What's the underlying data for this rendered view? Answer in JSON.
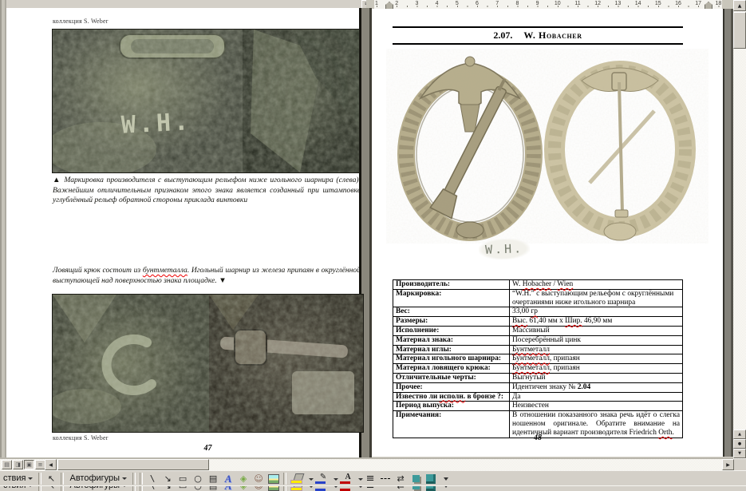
{
  "ui": {
    "ruler_numbers": [
      "1",
      "2",
      "3",
      "4",
      "5",
      "6",
      "7",
      "8",
      "9",
      "10",
      "11",
      "12",
      "13",
      "14",
      "15",
      "16",
      "17",
      "18"
    ],
    "drawing_toolbar": {
      "draw_menu_label": "ствия",
      "autoshapes_label": "Автофигуры",
      "icons": [
        {
          "name": "select-pointer-icon"
        },
        {
          "name": "sep",
          "sep": true
        },
        {
          "name": "line-icon"
        },
        {
          "name": "arrow-icon"
        },
        {
          "name": "rectangle-icon"
        },
        {
          "name": "oval-icon"
        },
        {
          "name": "text-box-icon"
        },
        {
          "name": "wordart-icon"
        },
        {
          "name": "diagram-icon"
        },
        {
          "name": "clip-art-icon"
        },
        {
          "name": "picture-icon"
        },
        {
          "name": "sep",
          "sep": true
        },
        {
          "name": "fill-color-icon",
          "dropdown": true
        },
        {
          "name": "line-color-icon",
          "dropdown": true
        },
        {
          "name": "font-color-icon",
          "dropdown": true
        },
        {
          "name": "line-style-icon"
        },
        {
          "name": "dash-style-icon"
        },
        {
          "name": "arrow-style-icon"
        },
        {
          "name": "shadow-style-icon"
        },
        {
          "name": "threed-style-icon"
        },
        {
          "name": "toolbar-options-icon"
        }
      ]
    }
  },
  "left_page": {
    "credit_top": "коллекция S. Weber",
    "credit_bottom": "коллекция S. Weber",
    "photo1_stamp": "W.H.",
    "caption1_parts": [
      {
        "t": "▲  ",
        "b": 1
      },
      {
        "t": "Маркировка производителя с выступающим рельефом ниже игольного шарнира (слева). Важнейшим отличительным признаком этого знака является созданный при штамповке углублённый рельеф обратной стороны  приклада винтовки"
      }
    ],
    "caption2_parts": [
      {
        "t": "Ловящий крюк состоит  из "
      },
      {
        "t": "бунтметалла",
        "sp": 1
      },
      {
        "t": ". Игольный шарнир из железа припаян в округлённой выступающей над поверхностью знака площадке. "
      },
      {
        "t": "▼",
        "b": 1
      }
    ],
    "page_number": "47"
  },
  "right_page": {
    "header_num": "2.07.",
    "header_title": "W. Hobacher",
    "stamp_text": "W.H.",
    "page_number": "48",
    "table": {
      "rows": [
        {
          "label": [
            {
              "t": "Производитель:"
            }
          ],
          "value": [
            {
              "t": "W. "
            },
            {
              "t": "Hobacher",
              "sp": 1
            },
            {
              "t": " / "
            },
            {
              "t": "Wien",
              "sp": 1
            }
          ]
        },
        {
          "label": [
            {
              "t": "Маркировка:"
            }
          ],
          "value": [
            {
              "t": "“W.H.” с выступающим рельефом с округлёнными очертаниями ниже игольного шарнира"
            }
          ]
        },
        {
          "label": [
            {
              "t": "Вес:"
            }
          ],
          "value": [
            {
              "t": "33,00 "
            },
            {
              "t": "гр",
              "sp": 1
            }
          ]
        },
        {
          "label": [
            {
              "t": "Размеры:"
            }
          ],
          "value": [
            {
              "t": "Выс.",
              "sp": 1
            },
            {
              "t": " 61,40 мм  х  "
            },
            {
              "t": "Шир.",
              "sp": 1
            },
            {
              "t": " 46,90 мм"
            }
          ]
        },
        {
          "label": [
            {
              "t": "Исполнение:"
            }
          ],
          "value": [
            {
              "t": "Массивный"
            }
          ]
        },
        {
          "label": [
            {
              "t": "Материал знака:"
            }
          ],
          "value": [
            {
              "t": "Посеребрённый цинк"
            }
          ]
        },
        {
          "label": [
            {
              "t": "Материал иглы:"
            }
          ],
          "value": [
            {
              "t": "Бунтметалл",
              "sp": 1
            }
          ]
        },
        {
          "label": [
            {
              "t": "Материал игольного шарнира:"
            }
          ],
          "value": [
            {
              "t": "Бунтметалл",
              "sp": 1
            },
            {
              "t": ", припаян"
            }
          ]
        },
        {
          "label": [
            {
              "t": "Материал ловящего крюка:"
            }
          ],
          "value": [
            {
              "t": "Бунтметалл",
              "sp": 1
            },
            {
              "t": ", припаян"
            }
          ]
        },
        {
          "label": [
            {
              "t": "Отличительные черты:"
            }
          ],
          "value": [
            {
              "t": "Выгнутый"
            }
          ]
        },
        {
          "label": [
            {
              "t": "Прочее:"
            }
          ],
          "value": [
            {
              "t": "Идентичен знаку № "
            },
            {
              "t": "2.04",
              "b": 1
            }
          ]
        },
        {
          "label": [
            {
              "t": "Известно ли "
            },
            {
              "t": "исполн.",
              "sp": 1
            },
            {
              "t": " в бронзе ?:"
            }
          ],
          "value": [
            {
              "t": "Да"
            }
          ]
        },
        {
          "label": [
            {
              "t": "Период выпуска:"
            }
          ],
          "value": [
            {
              "t": "Неизвестен"
            }
          ]
        },
        {
          "label": [
            {
              "t": "Примечания:"
            }
          ],
          "value": [
            {
              "t": "В отношении показанного знака речь идёт о слегка ношенном оригинале. Обратите внимание на идентичный вариант производителя Friedrich "
            },
            {
              "t": "Orth",
              "sp": 1
            },
            {
              "t": "."
            }
          ],
          "justify": true
        }
      ]
    }
  }
}
